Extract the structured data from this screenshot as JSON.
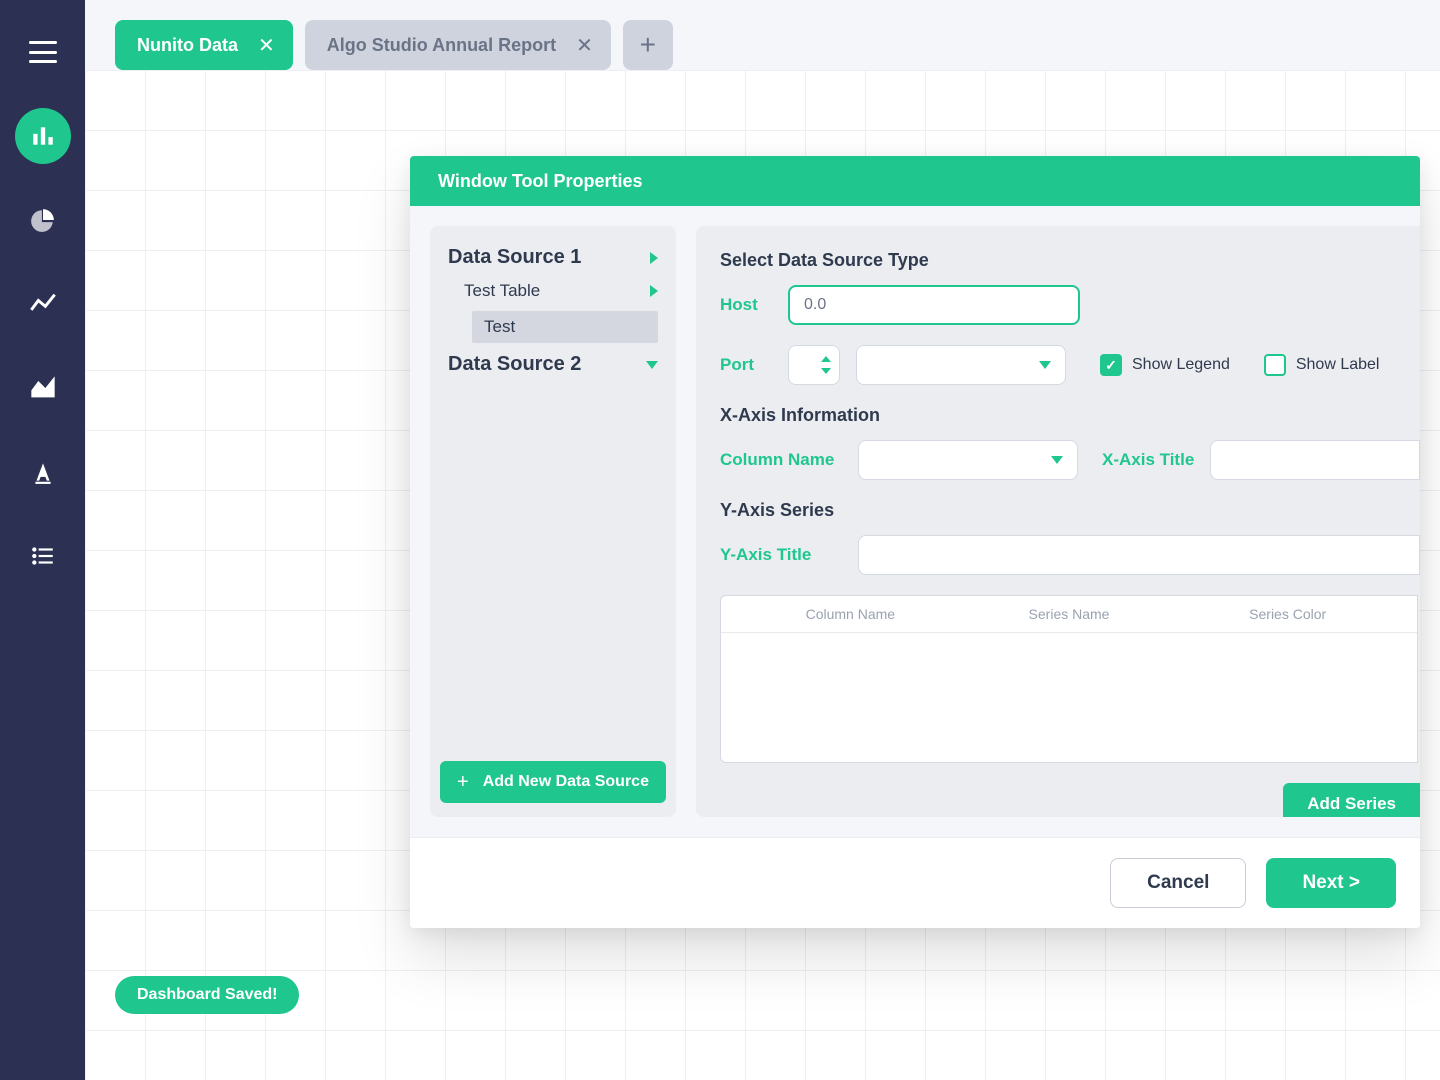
{
  "sidebar": {
    "items": [
      {
        "name": "menu-icon"
      },
      {
        "name": "bar-chart-icon",
        "active": true
      },
      {
        "name": "pie-chart-icon"
      },
      {
        "name": "line-chart-icon"
      },
      {
        "name": "area-chart-icon"
      },
      {
        "name": "text-style-icon"
      },
      {
        "name": "list-icon"
      }
    ]
  },
  "tabs": [
    {
      "label": "Nunito Data",
      "active": true
    },
    {
      "label": "Algo Studio Annual Report",
      "active": false
    }
  ],
  "toast": "Dashboard Saved!",
  "modal": {
    "title": "Window Tool Properties",
    "datasource_panel": {
      "sources": [
        {
          "label": "Data Source 1",
          "children": [
            {
              "label": "Test Table",
              "children": [
                {
                  "label": "Test"
                }
              ]
            }
          ]
        },
        {
          "label": "Data Source 2"
        }
      ],
      "add_button": "Add New Data Source"
    },
    "form": {
      "section_source_type": "Select Data Source Type",
      "host_label": "Host",
      "host_value": "0.0",
      "port_label": "Port",
      "show_legend": {
        "label": "Show Legend",
        "checked": true
      },
      "show_label": {
        "label": "Show Label",
        "checked": false
      },
      "section_xaxis": "X-Axis Information",
      "column_name_label": "Column Name",
      "xaxis_title_label": "X-Axis Title",
      "section_yseries": "Y-Axis Series",
      "yaxis_title_label": "Y-Axis Title",
      "series_table": {
        "headers": [
          "Column Name",
          "Series Name",
          "Series Color"
        ]
      },
      "add_series": "Add Series"
    },
    "footer": {
      "cancel": "Cancel",
      "next": "Next >"
    }
  }
}
